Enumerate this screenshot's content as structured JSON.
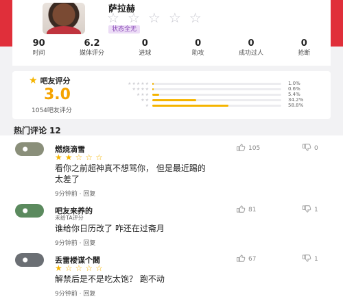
{
  "player": {
    "name": "萨拉赫",
    "status_badge": "状态全无",
    "rating_stars": 0
  },
  "stats": [
    {
      "value": "90",
      "label": "时间"
    },
    {
      "value": "6.2",
      "label": "媒体评分"
    },
    {
      "value": "0",
      "label": "进球"
    },
    {
      "value": "0",
      "label": "助攻"
    },
    {
      "value": "0",
      "label": "成功过人"
    },
    {
      "value": "0",
      "label": "抢断"
    }
  ],
  "fan_rating": {
    "title": "吧友评分",
    "score": "3.0",
    "count_label": "1054吧友评分",
    "distribution": [
      {
        "stars": 5,
        "percent": 1.0,
        "label": "1.0%"
      },
      {
        "stars": 4,
        "percent": 0.6,
        "label": "0.6%"
      },
      {
        "stars": 3,
        "percent": 5.4,
        "label": "5.4%"
      },
      {
        "stars": 2,
        "percent": 34.2,
        "label": "34.2%"
      },
      {
        "stars": 1,
        "percent": 58.8,
        "label": "58.8%"
      }
    ]
  },
  "comments_section": {
    "title": "热门评论",
    "count": "12"
  },
  "comments": [
    {
      "username": "燃烧滴雪",
      "stars": 2,
      "subtitle": "",
      "text_lines": [
        "看你之前超神真不想骂你， 但是最近踢的",
        "太差了"
      ],
      "time": "9分钟前",
      "reply": "回复",
      "likes": "105",
      "dislikes": "0",
      "avatar_color": "#8a8f7a"
    },
    {
      "username": "吧友来养的",
      "stars": null,
      "subtitle": "未给TA评分",
      "text_lines": [
        "谁给你日历改了  咋还在过斋月"
      ],
      "time": "9分钟前",
      "reply": "回复",
      "likes": "81",
      "dislikes": "1",
      "avatar_color": "#5b8a5e"
    },
    {
      "username": "丢雷楼谋个閪",
      "stars": 1,
      "subtitle": "",
      "text_lines": [
        "解禁后是不是吃太饱？ 跑不动"
      ],
      "time": "9分钟前",
      "reply": "回复",
      "likes": "67",
      "dislikes": "1",
      "avatar_color": "#6b6f74"
    }
  ],
  "colors": {
    "accent_red": "#e02f3a",
    "star_gold": "#f5b400",
    "score_orange": "#f5a300",
    "badge_bg": "#ecdcf6",
    "badge_text": "#8a4ab8"
  }
}
